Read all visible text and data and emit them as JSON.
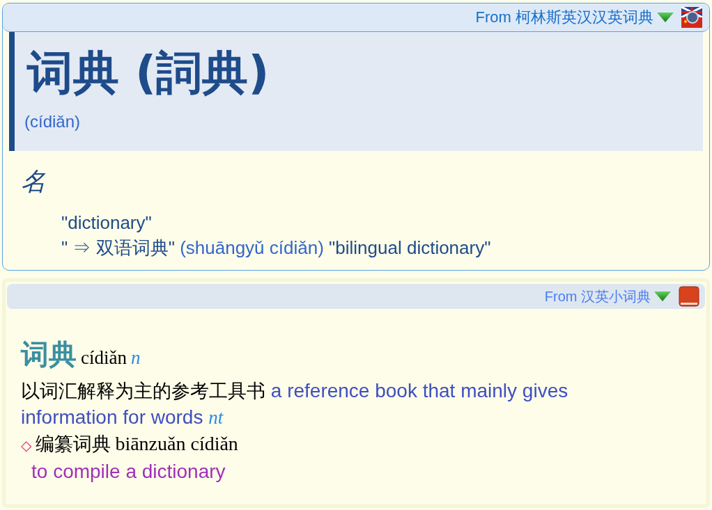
{
  "collins": {
    "source": "From 柯林斯英汉汉英词典",
    "headword": "词典 (詞典)",
    "pinyin": "(cídiǎn)",
    "pos": "名",
    "definitions": [
      [
        {
          "kind": "quote",
          "text": "\"dictionary\""
        }
      ],
      [
        {
          "kind": "quote",
          "text": "\" ⇒ 双语词典\""
        },
        {
          "kind": "pinyin",
          "text": "(shuāngyǔ cídiǎn)"
        },
        {
          "kind": "quote",
          "text": "\"bilingual dictionary\""
        }
      ]
    ]
  },
  "mini": {
    "source": "From 汉英小词典",
    "headword": "词典",
    "pinyin": "cídiǎn",
    "pos": "n",
    "definition": {
      "zh": "以词汇解释为主的参考工具书",
      "en": "a reference book that mainly gives information for words",
      "tag": "nt"
    },
    "example": {
      "marker": "◇",
      "zh": "编纂词典",
      "pinyin": "biānzuǎn cídiǎn",
      "translation": "to compile a dictionary"
    }
  }
}
